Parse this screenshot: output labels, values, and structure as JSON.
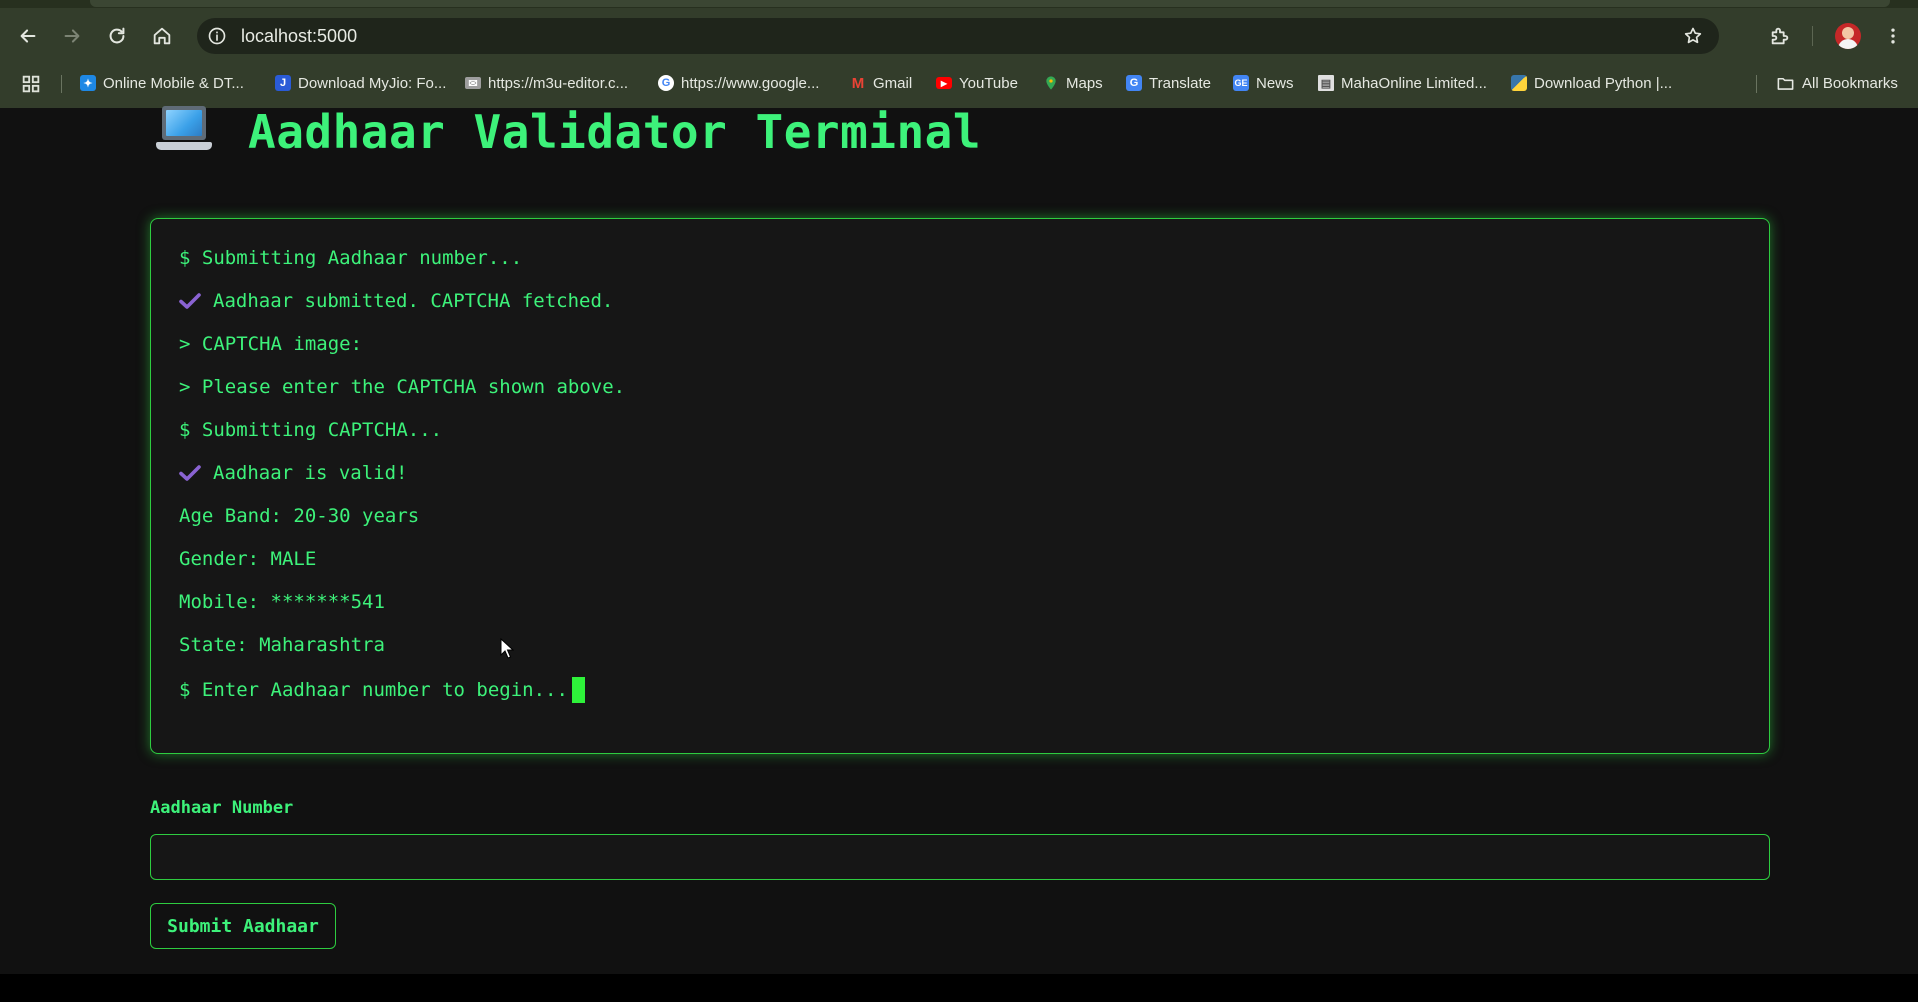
{
  "browser": {
    "url": "localhost:5000",
    "bookmarks": [
      {
        "label": "Online Mobile & DT...",
        "icon": "online-mobile-favicon",
        "color": "#1e88e5"
      },
      {
        "label": "Download MyJio: Fo...",
        "icon": "jio-favicon",
        "color": "#2a5bd7"
      },
      {
        "label": "https://m3u-editor.c...",
        "icon": "mail-favicon",
        "color": "#9e9e9e"
      },
      {
        "label": "https://www.google...",
        "icon": "google-favicon",
        "color": "#ffffff"
      },
      {
        "label": "Gmail",
        "icon": "gmail-favicon",
        "color": "#ea4335"
      },
      {
        "label": "YouTube",
        "icon": "youtube-favicon",
        "color": "#ff0000"
      },
      {
        "label": "Maps",
        "icon": "maps-favicon",
        "color": "#34a853"
      },
      {
        "label": "Translate",
        "icon": "translate-favicon",
        "color": "#4285f4"
      },
      {
        "label": "News",
        "icon": "news-favicon",
        "color": "#4285f4"
      },
      {
        "label": "MahaOnline Limited...",
        "icon": "document-favicon",
        "color": "#e0e0e0"
      },
      {
        "label": "Download Python |...",
        "icon": "python-favicon",
        "color": "#3776ab"
      }
    ],
    "all_bookmarks_label": "All Bookmarks"
  },
  "app": {
    "title": "Aadhaar Validator Terminal",
    "terminal_lines": [
      {
        "text": "$ Submitting Aadhaar number...",
        "check": false
      },
      {
        "text": "Aadhaar submitted. CAPTCHA fetched.",
        "check": true
      },
      {
        "text": "> CAPTCHA image:",
        "check": false
      },
      {
        "text": "> Please enter the CAPTCHA shown above.",
        "check": false
      },
      {
        "text": "$ Submitting CAPTCHA...",
        "check": false
      },
      {
        "text": "Aadhaar is valid!",
        "check": true
      },
      {
        "text": "Age Band: 20-30 years",
        "check": false
      },
      {
        "text": "Gender: MALE",
        "check": false
      },
      {
        "text": "Mobile: *******541",
        "check": false
      },
      {
        "text": "State: Maharashtra",
        "check": false
      },
      {
        "text": "$ Enter Aadhaar number to begin...",
        "check": false
      }
    ],
    "form": {
      "label": "Aadhaar Number",
      "value": "",
      "submit_label": "Submit Aadhaar"
    }
  },
  "colors": {
    "accent": "#3df27a",
    "border": "#2ecc40",
    "background": "#111111",
    "check": "#8a63d2"
  }
}
